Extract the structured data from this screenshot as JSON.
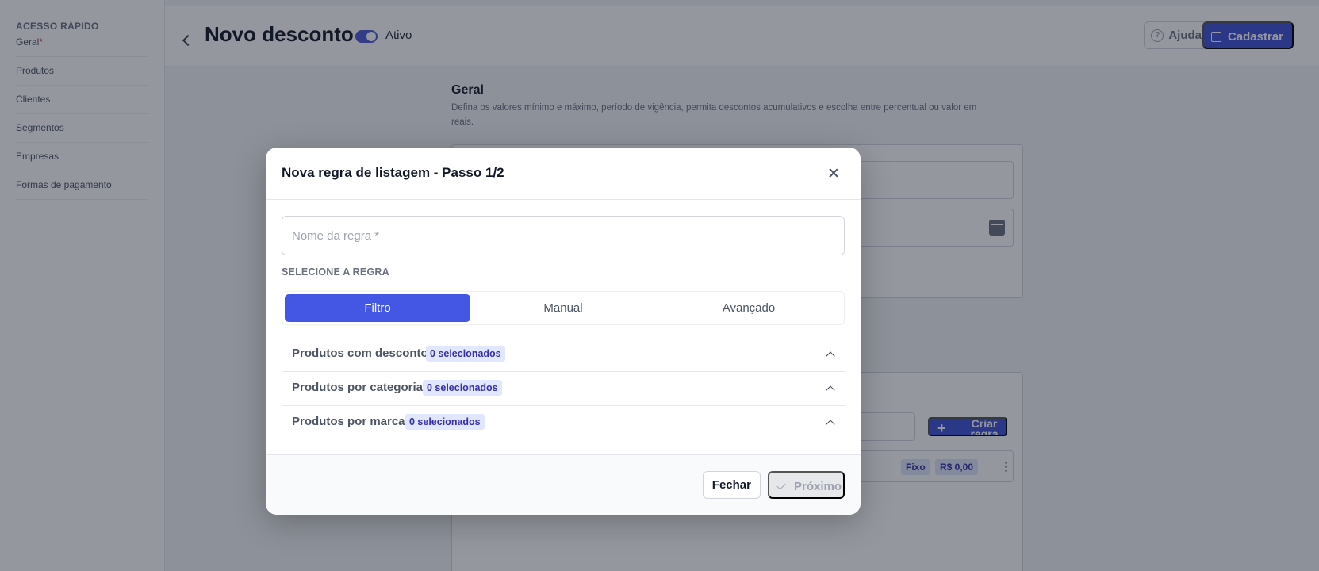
{
  "sidebar": {
    "title": "ACESSO RÁPIDO",
    "items": [
      {
        "label": "Geral",
        "required_mark": "*"
      },
      {
        "label": "Produtos"
      },
      {
        "label": "Clientes"
      },
      {
        "label": "Segmentos"
      },
      {
        "label": "Empresas"
      },
      {
        "label": "Formas de pagamento"
      }
    ]
  },
  "header": {
    "title": "Novo desconto",
    "status_label": "Ativo",
    "help_label": "Ajuda",
    "save_label": "Cadastrar"
  },
  "general_section": {
    "title": "Geral",
    "description": "Defina os valores mínimo e máximo, período de vigência, permita descontos acumulativos e escolha entre percentual ou valor em reais."
  },
  "rules_card": {
    "create_rule_label": "Criar regra",
    "rule_type_chip": "Fixo",
    "rule_value_chip": "R$ 0,00"
  },
  "modal": {
    "title": "Nova regra de listagem - Passo 1/2",
    "rule_name_placeholder": "Nome da regra *",
    "select_rule_label": "SELECIONE A REGRA",
    "tabs": [
      {
        "label": "Filtro",
        "active": true
      },
      {
        "label": "Manual",
        "active": false
      },
      {
        "label": "Avançado",
        "active": false
      }
    ],
    "accordion": [
      {
        "label": "Produtos com desconto",
        "badge": "0 selecionados"
      },
      {
        "label": "Produtos por categoria",
        "badge": "0 selecionados"
      },
      {
        "label": "Produtos por marca",
        "badge": "0 selecionados"
      }
    ],
    "close_label": "Fechar",
    "next_label": "Próximo"
  },
  "colors": {
    "accent": "#4456e4",
    "badge_bg": "#e0e7ff",
    "badge_text": "#3730a3"
  }
}
